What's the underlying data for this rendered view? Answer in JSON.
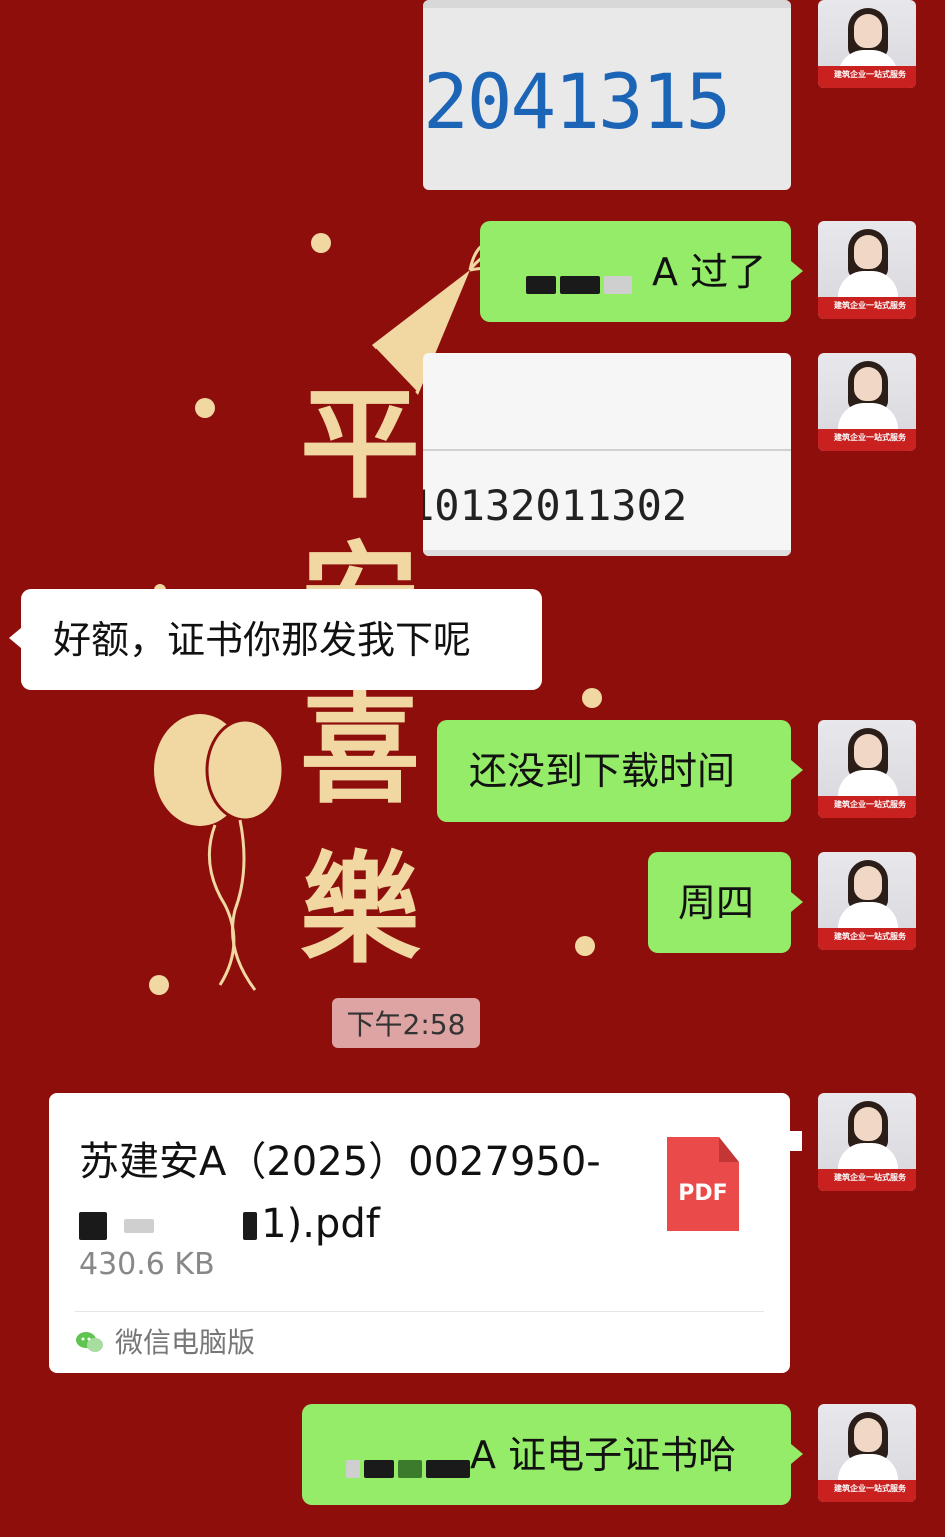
{
  "background": {
    "color": "#8e0e0b",
    "decor_chars": [
      "平",
      "安",
      "喜",
      "樂"
    ]
  },
  "messages": [
    {
      "id": "img1",
      "type": "image",
      "sender": "self",
      "content": "2041315"
    },
    {
      "id": "m1",
      "type": "text",
      "sender": "self",
      "text": "A 过了"
    },
    {
      "id": "img2",
      "type": "image",
      "sender": "self",
      "content": "10132011302"
    },
    {
      "id": "m2",
      "type": "text",
      "sender": "other",
      "text": "好额，证书你那发我下呢"
    },
    {
      "id": "m3",
      "type": "text",
      "sender": "self",
      "text": "还没到下载时间"
    },
    {
      "id": "m4",
      "type": "text",
      "sender": "self",
      "text": "周四"
    },
    {
      "id": "file1",
      "type": "file",
      "sender": "self",
      "name_line1": "苏建安A（2025）0027950-",
      "name_line2_tail": "1).pdf",
      "size": "430.6 KB",
      "source": "微信电脑版",
      "icon_label": "PDF"
    },
    {
      "id": "m5",
      "type": "text",
      "sender": "self",
      "text": "A 证电子证书哈"
    }
  ],
  "timestamp": "下午2:58",
  "avatar": {
    "banner_text": "建筑企业一站式服务"
  },
  "colors": {
    "green_bubble": "#95ec69",
    "white_bubble": "#ffffff",
    "pdf_red": "#ea4a4a"
  }
}
